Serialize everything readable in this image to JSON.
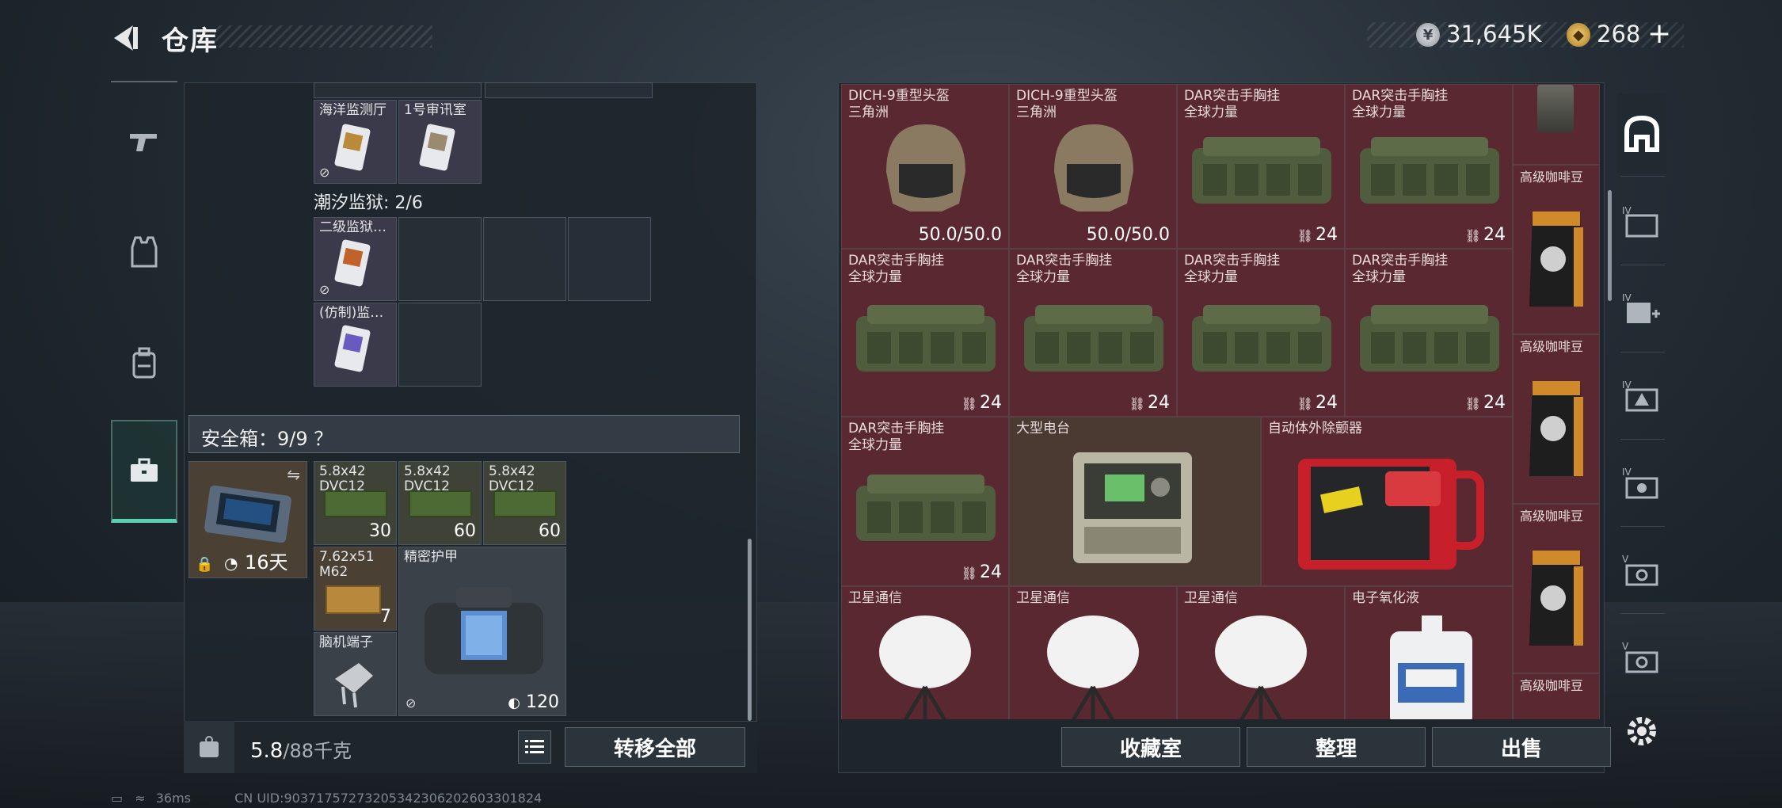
{
  "header": {
    "title": "仓库",
    "silver_value": "31,645K",
    "gold_value": "268",
    "plus_label": "+"
  },
  "sidebar": {
    "items": [
      {
        "name": "weapons",
        "icon": "gun-icon"
      },
      {
        "name": "gear",
        "icon": "vest-icon"
      },
      {
        "name": "backpack",
        "icon": "backpack-icon"
      },
      {
        "name": "safebox",
        "icon": "briefcase-icon",
        "active": true
      }
    ]
  },
  "left_panel": {
    "keycards_top": [
      "海洋监测厅",
      "1号审讯室"
    ],
    "prison_label": "潮汐监狱: 2/6",
    "prison_cards": [
      "二级监狱…",
      "(仿制)监…"
    ],
    "safebox_label": "安全箱：9/9 ？",
    "safebox_timer": "16天",
    "items": [
      {
        "label": "5.8x42\nDVC12",
        "count": "30"
      },
      {
        "label": "5.8x42\nDVC12",
        "count": "60"
      },
      {
        "label": "5.8x42\nDVC12",
        "count": "60"
      },
      {
        "label": "7.62x51\nM62",
        "count": "7"
      },
      {
        "label": "精密护甲",
        "count": "120"
      },
      {
        "label": "脑机端子",
        "count": ""
      }
    ],
    "weight_current": "5.8",
    "weight_max": "/88千克",
    "move_all_label": "转移全部"
  },
  "right_panel": {
    "cells": [
      {
        "label": "DICH-9重型头盔\n三角洲",
        "value": "50.0/50.0"
      },
      {
        "label": "DICH-9重型头盔\n三角洲",
        "value": "50.0/50.0"
      },
      {
        "label": "DAR突击手胸挂\n全球力量",
        "value": "24"
      },
      {
        "label": "DAR突击手胸挂\n全球力量",
        "value": "24"
      },
      {
        "label": "DAR突击手胸挂\n全球力量",
        "value": "24"
      },
      {
        "label": "DAR突击手胸挂\n全球力量",
        "value": "24"
      },
      {
        "label": "DAR突击手胸挂\n全球力量",
        "value": "24"
      },
      {
        "label": "DAR突击手胸挂\n全球力量",
        "value": "24"
      },
      {
        "label": "DAR突击手胸挂\n全球力量",
        "value": "24"
      },
      {
        "label": "大型电台",
        "value": ""
      },
      {
        "label": "自动体外除颤器",
        "value": ""
      },
      {
        "label": "卫星通信",
        "value": ""
      },
      {
        "label": "卫星通信",
        "value": ""
      },
      {
        "label": "卫星通信",
        "value": ""
      },
      {
        "label": "电子氧化液",
        "value": ""
      }
    ],
    "side_column_labels": [
      "高级咖啡豆",
      "高级咖啡豆",
      "高级咖啡豆",
      "高级咖啡豆"
    ],
    "buttons": {
      "collection": "收藏室",
      "organize": "整理",
      "sell": "出售"
    }
  },
  "right_tabs": [
    "IV",
    "IV+",
    "IV",
    "IV",
    "V",
    "V"
  ],
  "status_bar": {
    "ping": "36ms",
    "uid": "CN UID:9037175727320534230620260330​1824"
  }
}
